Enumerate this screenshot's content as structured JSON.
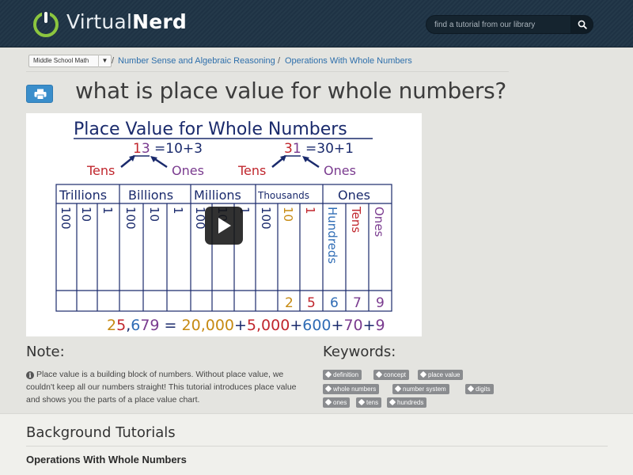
{
  "header": {
    "logo_part1": "Virtual",
    "logo_part2": "Nerd",
    "search_placeholder": "find a tutorial from our library",
    "search_button_icon": "search-icon"
  },
  "breadcrumb": {
    "subject": "Middle School Math",
    "items": [
      {
        "label": "Number Sense and Algebraic Reasoning"
      },
      {
        "label": "Operations With Whole Numbers"
      }
    ],
    "separator": "/"
  },
  "page": {
    "title": "what is place value for whole numbers?",
    "print_icon": "print-icon"
  },
  "video": {
    "board_title": "Place Value for Whole Numbers",
    "example1": "13 = 10+3",
    "example2": "31 = 30+1",
    "tens_label": "Tens",
    "ones_label": "Ones",
    "periods": [
      "Trillions",
      "Billions",
      "Millions",
      "Thousands",
      "Ones"
    ],
    "place_headers": [
      "100",
      "10",
      "1",
      "100",
      "10",
      "1",
      "100",
      "10",
      "1",
      "100",
      "10",
      "1"
    ],
    "ones_period_headers": [
      "Hundreds",
      "Tens",
      "Ones"
    ],
    "digits": [
      "2",
      "5",
      "6",
      "7",
      "9"
    ],
    "expanded": {
      "number": "25,679",
      "parts": [
        "20,000",
        "5,000",
        "600",
        "70",
        "9"
      ]
    },
    "colors": {
      "navy": "#1a2a6c",
      "red": "#c0262d",
      "purple": "#7a3b8f",
      "gold": "#c68a12",
      "blue": "#2f6cb5"
    }
  },
  "note": {
    "heading": "Note:",
    "text": "Place value is a building block of numbers. Without place value, we couldn't keep all our numbers straight! This tutorial introduces place value and shows you the parts of a place value chart."
  },
  "keywords": {
    "heading": "Keywords:",
    "tags": [
      "definition",
      "concept",
      "place value",
      "whole numbers",
      "number system",
      "digits",
      "ones",
      "tens",
      "hundreds"
    ]
  },
  "background": {
    "heading": "Background Tutorials",
    "link": "Operations With Whole Numbers"
  }
}
